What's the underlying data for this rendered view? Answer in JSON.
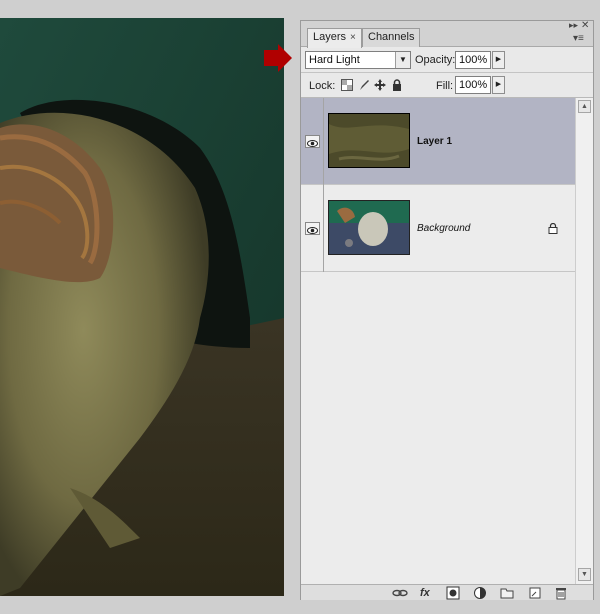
{
  "panel": {
    "tabs": [
      {
        "label": "Layers",
        "close": "×"
      },
      {
        "label": "Channels"
      }
    ],
    "minimize": "▸▸",
    "close": "✕",
    "menu": "▾≡"
  },
  "blend": {
    "mode": "Hard Light",
    "opacity_label": "Opacity:",
    "opacity_value": "100%",
    "fill_label": "Fill:",
    "fill_value": "100%"
  },
  "lock": {
    "label": "Lock:"
  },
  "layers": [
    {
      "name": "Layer 1",
      "selected": true,
      "visible": true,
      "locked": false
    },
    {
      "name": "Background",
      "selected": false,
      "visible": true,
      "locked": true
    }
  ],
  "footer_icons": [
    "link-icon",
    "fx-icon",
    "mask-icon",
    "adjustment-icon",
    "folder-icon",
    "new-layer-icon",
    "trash-icon"
  ],
  "footer_fx": "fx",
  "colors": {
    "selection": "#b2b4c4",
    "arrow": "#b00000",
    "panel_bg": "#e9e9e9"
  }
}
